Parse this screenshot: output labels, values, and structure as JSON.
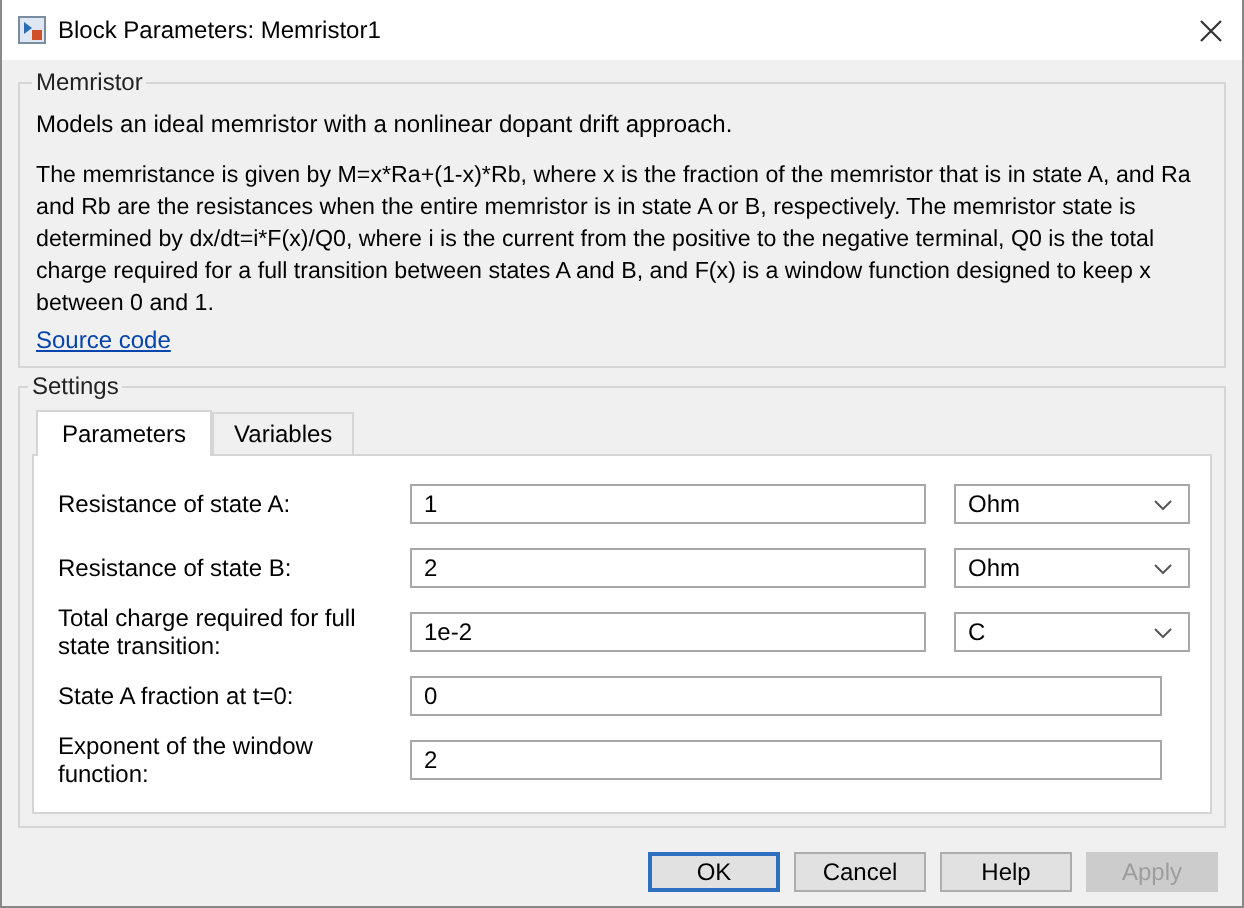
{
  "window": {
    "title": "Block Parameters: Memristor1"
  },
  "description": {
    "group_title": "Memristor",
    "summary": "Models an ideal memristor with a nonlinear dopant drift approach.",
    "details": "The memristance is given by M=x*Ra+(1-x)*Rb, where x is the fraction of the memristor that is in state A, and Ra and Rb are the resistances when the entire memristor is in state A or B, respectively. The memristor state is determined by dx/dt=i*F(x)/Q0, where i is the current from the positive to the negative terminal, Q0 is the total charge required for a full transition between states A and B, and F(x) is a window function designed to keep x between 0 and 1.",
    "link": "Source code"
  },
  "settings": {
    "group_title": "Settings",
    "tabs": [
      {
        "label": "Parameters",
        "selected": true
      },
      {
        "label": "Variables",
        "selected": false
      }
    ],
    "parameters": [
      {
        "label": "Resistance of state A:",
        "value": "1",
        "unit": "Ohm"
      },
      {
        "label": "Resistance of state B:",
        "value": "2",
        "unit": "Ohm"
      },
      {
        "label": "Total charge required for full state transition:",
        "value": "1e-2",
        "unit": "C"
      },
      {
        "label": "State A fraction at t=0:",
        "value": "0"
      },
      {
        "label": "Exponent of the window function:",
        "value": "2"
      }
    ]
  },
  "buttons": [
    {
      "label": "OK",
      "default": true,
      "disabled": false
    },
    {
      "label": "Cancel",
      "default": false,
      "disabled": false
    },
    {
      "label": "Help",
      "default": false,
      "disabled": false
    },
    {
      "label": "Apply",
      "default": false,
      "disabled": true
    }
  ]
}
